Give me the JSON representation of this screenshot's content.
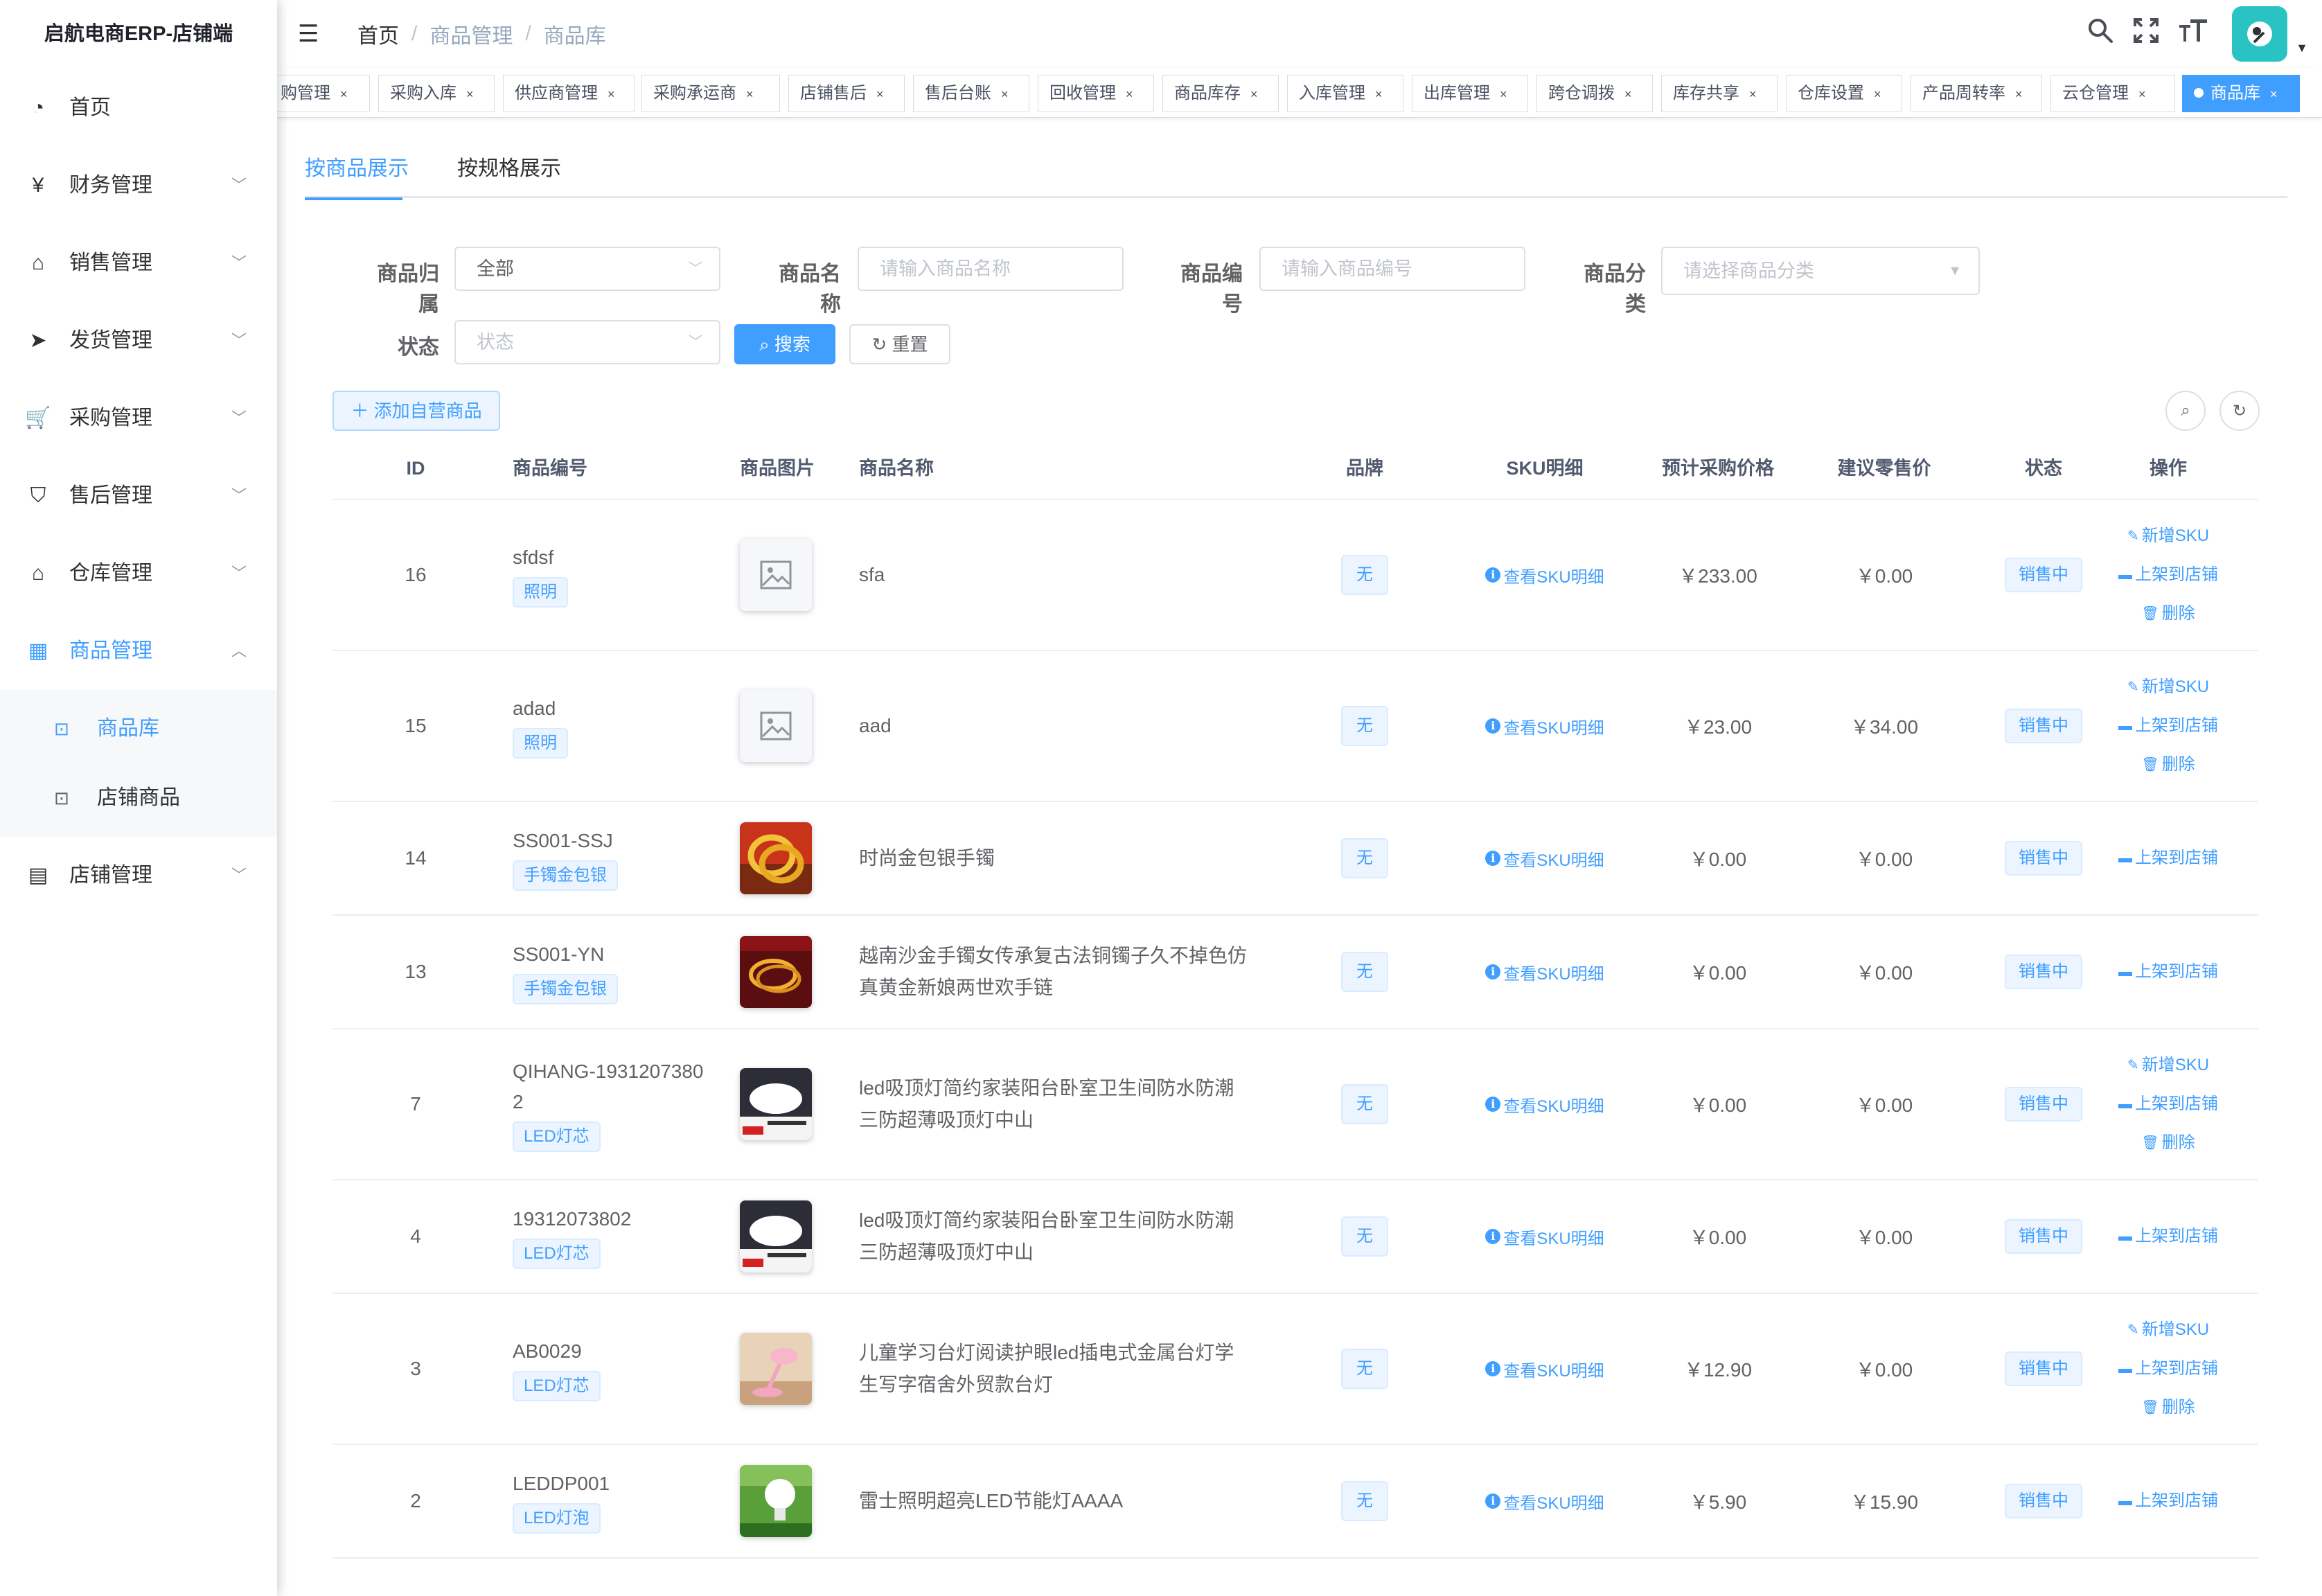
{
  "app": {
    "brand": "启航电商ERP-店铺端"
  },
  "sidebar": {
    "items": [
      {
        "label": "首页",
        "icon": "dashboard-icon",
        "glyph": "◔",
        "expandable": false
      },
      {
        "label": "财务管理",
        "icon": "finance-icon",
        "glyph": "¥",
        "expandable": true
      },
      {
        "label": "销售管理",
        "icon": "sales-icon",
        "glyph": "⌂",
        "expandable": true
      },
      {
        "label": "发货管理",
        "icon": "send-icon",
        "glyph": "➤",
        "expandable": true
      },
      {
        "label": "采购管理",
        "icon": "cart-icon",
        "glyph": "🛒",
        "expandable": true
      },
      {
        "label": "售后管理",
        "icon": "shield-icon",
        "glyph": "⛉",
        "expandable": true
      },
      {
        "label": "仓库管理",
        "icon": "warehouse-icon",
        "glyph": "⌂",
        "expandable": true
      },
      {
        "label": "商品管理",
        "icon": "table-icon",
        "glyph": "▦",
        "expandable": true,
        "active": true
      },
      {
        "label": "店铺管理",
        "icon": "store-icon",
        "glyph": "▤",
        "expandable": true
      }
    ],
    "product_sub": [
      {
        "label": "商品库",
        "icon": "bag-icon",
        "active": true
      },
      {
        "label": "店铺商品",
        "icon": "bag-icon",
        "active": false
      }
    ]
  },
  "header": {
    "breadcrumb": [
      "首页",
      "商品管理",
      "商品库"
    ],
    "icons": [
      "search-icon",
      "fullscreen-icon",
      "font-size-icon"
    ]
  },
  "tags": [
    {
      "label": "购管理"
    },
    {
      "label": "采购入库"
    },
    {
      "label": "供应商管理"
    },
    {
      "label": "采购承运商"
    },
    {
      "label": "店铺售后"
    },
    {
      "label": "售后台账"
    },
    {
      "label": "回收管理"
    },
    {
      "label": "商品库存"
    },
    {
      "label": "入库管理"
    },
    {
      "label": "出库管理"
    },
    {
      "label": "跨仓调拨"
    },
    {
      "label": "库存共享"
    },
    {
      "label": "仓库设置"
    },
    {
      "label": "产品周转率"
    },
    {
      "label": "云仓管理"
    },
    {
      "label": "商品库",
      "active": true
    }
  ],
  "tabs": [
    {
      "label": "按商品展示",
      "active": true
    },
    {
      "label": "按规格展示",
      "active": false
    }
  ],
  "filters": {
    "owner_label": "商品归属",
    "owner_value": "全部",
    "name_label": "商品名称",
    "name_placeholder": "请输入商品名称",
    "code_label": "商品编号",
    "code_placeholder": "请输入商品编号",
    "category_label": "商品分类",
    "category_placeholder": "请选择商品分类",
    "status_label": "状态",
    "status_placeholder": "状态",
    "search_button": "搜索",
    "reset_button": "重置"
  },
  "toolbar": {
    "add_button": "添加自营商品"
  },
  "table": {
    "headers": {
      "id": "ID",
      "code": "商品编号",
      "image": "商品图片",
      "name": "商品名称",
      "brand": "品牌",
      "sku": "SKU明细",
      "purchase_price": "预计采购价格",
      "retail_price": "建议零售价",
      "status": "状态",
      "ops": "操作"
    },
    "rows": [
      {
        "id": "16",
        "code": "sfdsf",
        "category": "照明",
        "image": "placeholder",
        "name": "sfa",
        "brand": "无",
        "sku": "查看SKU明细",
        "purchase_price": "￥233.00",
        "retail_price": "￥0.00",
        "status": "销售中",
        "ops": [
          "新增SKU",
          "上架到店铺",
          "删除"
        ]
      },
      {
        "id": "15",
        "code": "adad",
        "category": "照明",
        "image": "placeholder",
        "name": "aad",
        "brand": "无",
        "sku": "查看SKU明细",
        "purchase_price": "￥23.00",
        "retail_price": "￥34.00",
        "status": "销售中",
        "ops": [
          "新增SKU",
          "上架到店铺",
          "删除"
        ]
      },
      {
        "id": "14",
        "code": "SS001-SSJ",
        "category": "手镯金包银",
        "image": "bracelet-gold",
        "name": "时尚金包银手镯",
        "brand": "无",
        "sku": "查看SKU明细",
        "purchase_price": "￥0.00",
        "retail_price": "￥0.00",
        "status": "销售中",
        "ops": [
          "上架到店铺"
        ]
      },
      {
        "id": "13",
        "code": "SS001-YN",
        "category": "手镯金包银",
        "image": "bracelet-red",
        "name": "越南沙金手镯女传承复古法铜镯子久不掉色仿真黄金新娘两世欢手链",
        "brand": "无",
        "sku": "查看SKU明细",
        "purchase_price": "￥0.00",
        "retail_price": "￥0.00",
        "status": "销售中",
        "ops": [
          "上架到店铺"
        ]
      },
      {
        "id": "7",
        "code": "QIHANG-19312073802",
        "category": "LED灯芯",
        "image": "ceiling-lamp",
        "name": "led吸顶灯简约家装阳台卧室卫生间防水防潮三防超薄吸顶灯中山",
        "brand": "无",
        "sku": "查看SKU明细",
        "purchase_price": "￥0.00",
        "retail_price": "￥0.00",
        "status": "销售中",
        "ops": [
          "新增SKU",
          "上架到店铺",
          "删除"
        ]
      },
      {
        "id": "4",
        "code": "19312073802",
        "category": "LED灯芯",
        "image": "ceiling-lamp",
        "name": "led吸顶灯简约家装阳台卧室卫生间防水防潮三防超薄吸顶灯中山",
        "brand": "无",
        "sku": "查看SKU明细",
        "purchase_price": "￥0.00",
        "retail_price": "￥0.00",
        "status": "销售中",
        "ops": [
          "上架到店铺"
        ]
      },
      {
        "id": "3",
        "code": "AB0029",
        "category": "LED灯芯",
        "image": "desk-lamp",
        "name": "儿童学习台灯阅读护眼led插电式金属台灯学生写字宿舍外贸款台灯",
        "brand": "无",
        "sku": "查看SKU明细",
        "purchase_price": "￥12.90",
        "retail_price": "￥0.00",
        "status": "销售中",
        "ops": [
          "新增SKU",
          "上架到店铺",
          "删除"
        ]
      },
      {
        "id": "2",
        "code": "LEDDP001",
        "category": "LED灯泡",
        "image": "bulb",
        "name": "雷士照明超亮LED节能灯AAAA",
        "brand": "无",
        "sku": "查看SKU明细",
        "purchase_price": "￥5.90",
        "retail_price": "￥15.90",
        "status": "销售中",
        "ops": [
          "上架到店铺"
        ]
      }
    ]
  },
  "colors": {
    "primary": "#409eff",
    "avatar": "#29c3c3",
    "text": "#606266"
  }
}
